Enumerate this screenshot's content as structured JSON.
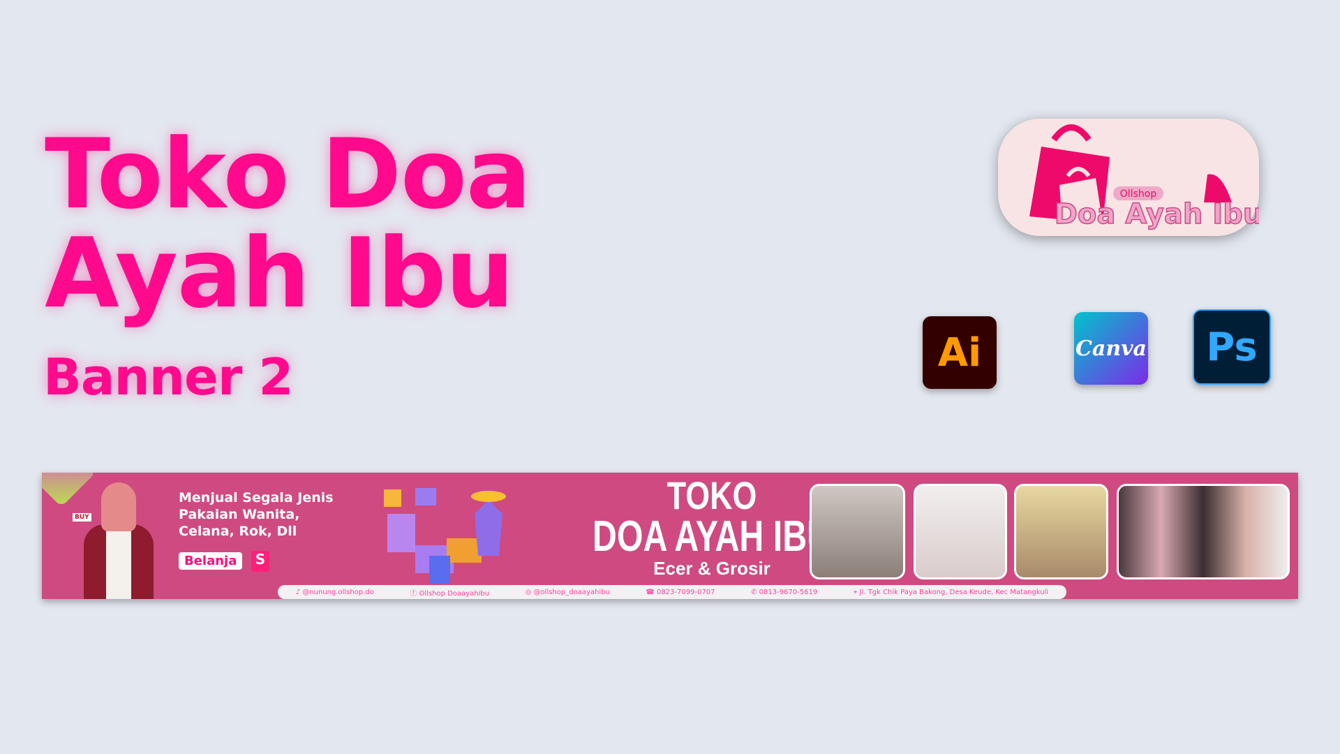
{
  "heading": {
    "line1": "Toko Doa",
    "line2": "Ayah Ibu",
    "subtitle": "Banner 2"
  },
  "logo": {
    "tag": "Ollshop",
    "name": "Doa Ayah Ibu"
  },
  "apps": [
    {
      "label": "Ai",
      "icon": "illustrator-icon"
    },
    {
      "label": "Canva",
      "icon": "canva-icon"
    },
    {
      "label": "Ps",
      "icon": "photoshop-icon"
    }
  ],
  "banner": {
    "tagline": [
      "Menjual Segala Jenis",
      "Pakaian Wanita,",
      "Celana, Rok, Dll"
    ],
    "buy_tag": "BUY",
    "button": "Belanja",
    "shopee": "S",
    "title1": "TOKO",
    "title2": "DOA AYAH IBU",
    "title3": "Ecer & Grosir",
    "contacts": [
      {
        "icon": "tiktok-icon",
        "text": "@nunung.ollshop.do"
      },
      {
        "icon": "facebook-icon",
        "text": "Ollshop Doaayahibu"
      },
      {
        "icon": "instagram-icon",
        "text": "@ollshop_doaayahibu"
      },
      {
        "icon": "phone-icon",
        "text": "0823-7099-0707"
      },
      {
        "icon": "whatsapp-icon",
        "text": "0813-9670-5619"
      },
      {
        "icon": "location-icon",
        "text": "Jl. Tgk Chik Paya Bakong, Desa Keude, Kec Matangkuli"
      }
    ]
  },
  "colors": {
    "accent": "#ff0a8c",
    "banner": "#cf4a80",
    "background": "#e3e7ef"
  }
}
